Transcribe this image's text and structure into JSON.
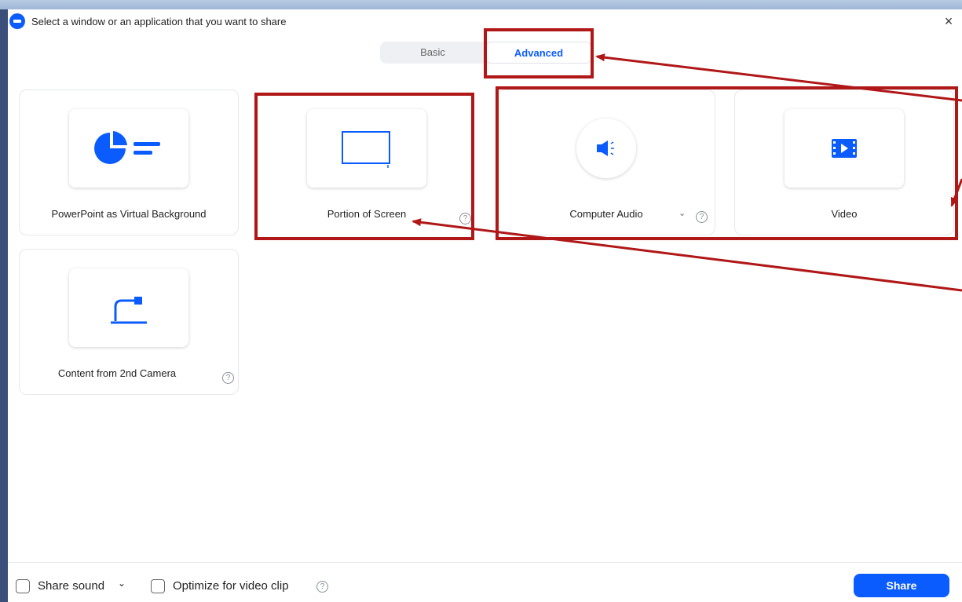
{
  "window": {
    "title": "Select a window or an application that you want to share",
    "close_label": "×"
  },
  "tabs": [
    {
      "label": "Basic",
      "active": false
    },
    {
      "label": "Advanced",
      "active": true
    }
  ],
  "options": {
    "powerpoint": {
      "label": "PowerPoint as Virtual Background",
      "icon": "pie-chart-icon"
    },
    "portion": {
      "label": "Portion of Screen",
      "icon": "screen-portion-icon",
      "help": "?"
    },
    "audio": {
      "label": "Computer Audio",
      "icon": "speaker-icon",
      "chevron": "⌄",
      "help": "?"
    },
    "video": {
      "label": "Video",
      "icon": "film-icon"
    },
    "camera": {
      "label": "Content from 2nd Camera",
      "icon": "document-camera-icon",
      "help": "?"
    }
  },
  "footer": {
    "share_sound": "Share sound",
    "share_sound_chevron": "⌄",
    "optimize": "Optimize for video clip",
    "help": "?",
    "share_button": "Share"
  },
  "colors": {
    "accent": "#0b5cff",
    "annotation": "#b01717"
  }
}
